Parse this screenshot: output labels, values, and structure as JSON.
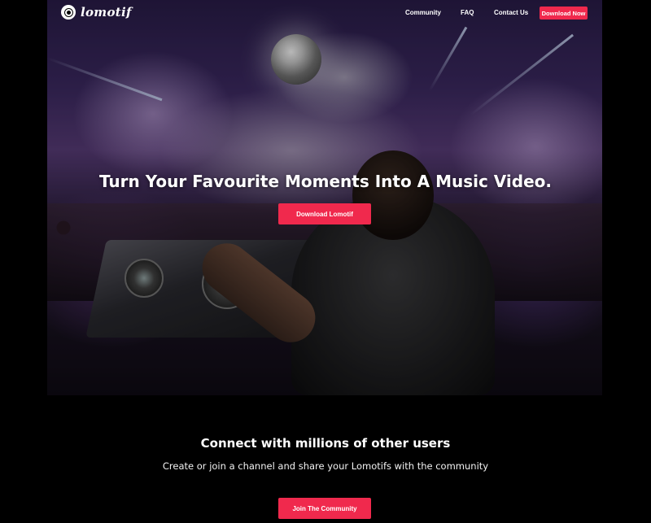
{
  "brand": {
    "name": "lomotif",
    "logo_icon": "lomotif-logo-icon"
  },
  "nav": {
    "links": [
      "Community",
      "FAQ",
      "Contact Us"
    ],
    "cta_label": "Download Now"
  },
  "hero": {
    "title": "Turn Your Favourite Moments Into A Music Video.",
    "cta_label": "Download Lomotif",
    "image_alt": "dj-crowd-photo"
  },
  "community": {
    "title": "Connect with millions of other users",
    "subtitle": "Create or join a channel and share your Lomotifs with the community",
    "cta_label": "Join The Community"
  },
  "colors": {
    "accent": "#f0294d",
    "background": "#000000",
    "text": "#ffffff"
  }
}
